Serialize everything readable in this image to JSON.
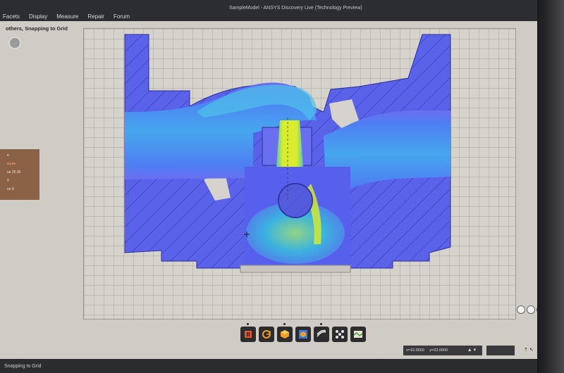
{
  "window": {
    "title": "SampleModel - ANSYS Discovery Live (Technology Preview)"
  },
  "menu": {
    "items": [
      "Facets",
      "Display",
      "Measure",
      "Repair",
      "Forum"
    ]
  },
  "status_top": "others, Snapping to Grid",
  "side_panel": {
    "lines": [
      "e",
      "ssure",
      "ue  25.30",
      "  0",
      "on  0"
    ]
  },
  "toolbar": {
    "icons": [
      "pause-icon",
      "rotate-icon",
      "box-icon",
      "cube-select-icon",
      "flow-icon",
      "dots-icon",
      "map-icon"
    ]
  },
  "coords": {
    "x": "x=10.0000",
    "y": "y=23.0000"
  },
  "status_bottom": "Snapping to Grid",
  "colors": {
    "solid": "#5d63ec",
    "flow_low": "#4c79ef",
    "flow_mid": "#2fb9e6",
    "flow_high": "#d6ea2c",
    "workspace_bg": "#d6d2cc"
  }
}
